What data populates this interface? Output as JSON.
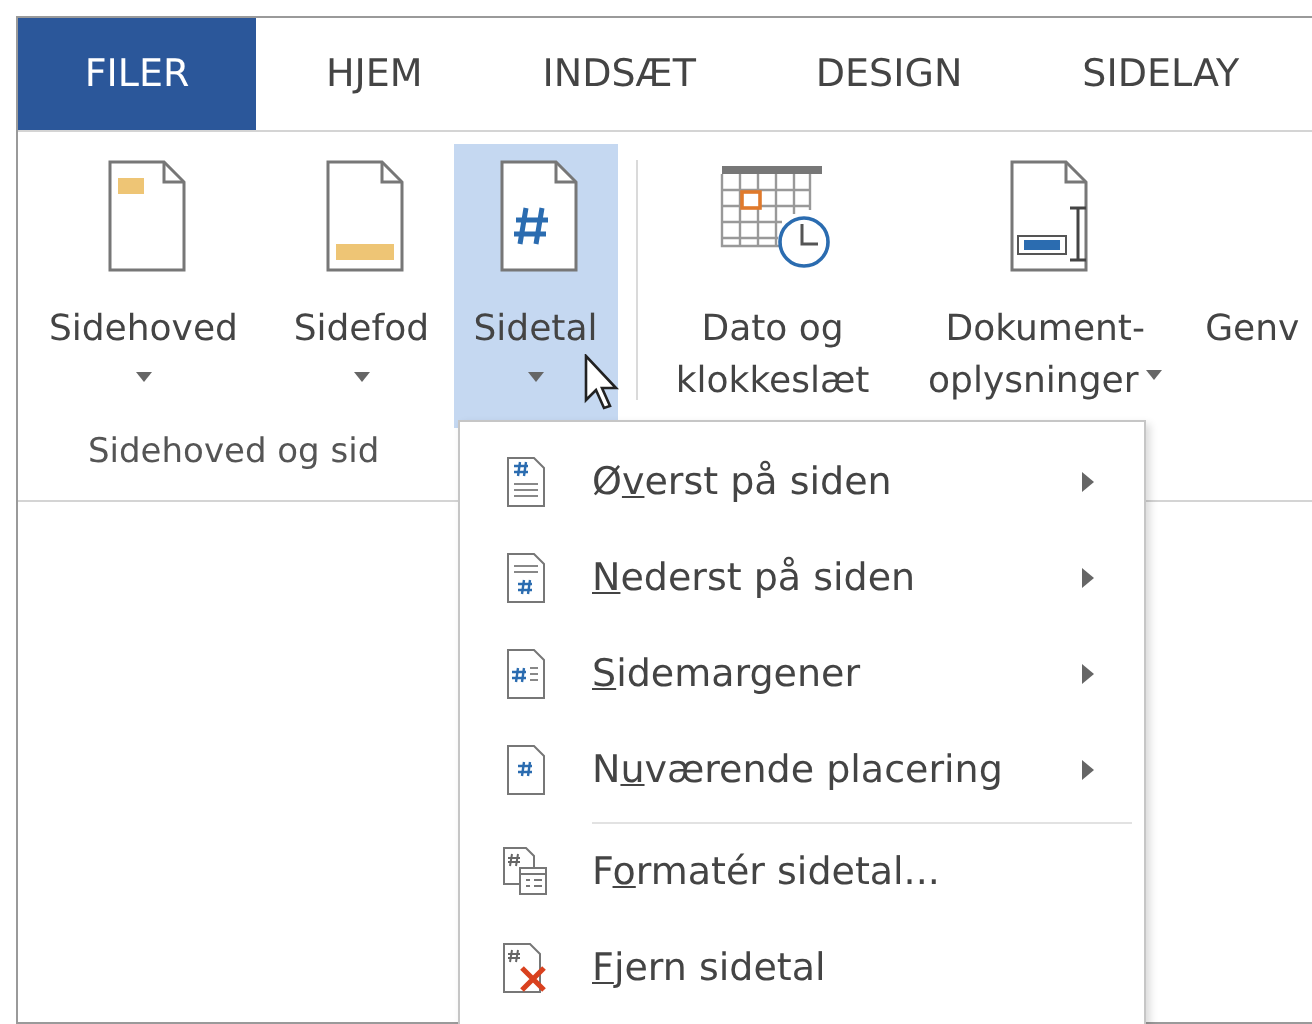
{
  "tabs": [
    {
      "label": "FILER",
      "selected": true
    },
    {
      "label": "HJEM",
      "selected": false
    },
    {
      "label": "INDSÆT",
      "selected": false
    },
    {
      "label": "DESIGN",
      "selected": false
    },
    {
      "label": "SIDELAY",
      "selected": false
    }
  ],
  "ribbon": {
    "buttons": [
      {
        "lines": [
          "Sidehoved"
        ],
        "dropdown": true,
        "selected": false
      },
      {
        "lines": [
          "Sidefod"
        ],
        "dropdown": true,
        "selected": false
      },
      {
        "lines": [
          "Sidetal"
        ],
        "dropdown": true,
        "selected": true
      },
      {
        "lines": [
          "Dato og",
          "klokkeslæt"
        ],
        "dropdown": false,
        "selected": false
      },
      {
        "lines": [
          "Dokument-",
          "oplysninger"
        ],
        "dropdown": true,
        "selected": false
      },
      {
        "lines": [
          "Genv"
        ],
        "dropdown": false,
        "selected": false
      }
    ],
    "group_label": "Sidehoved og sid"
  },
  "menu": {
    "items": [
      {
        "pre": "Ø",
        "key": "v",
        "post": "erst på siden",
        "kind": "submenu"
      },
      {
        "key": "N",
        "post": "ederst på siden",
        "kind": "submenu"
      },
      {
        "key": "S",
        "post": "idemargener",
        "kind": "submenu"
      },
      {
        "pre": "N",
        "key": "u",
        "post": "værende placering",
        "kind": "submenu"
      },
      {
        "pre": "F",
        "key": "o",
        "post": "rmatér sidetal...",
        "kind": "action"
      },
      {
        "key": "F",
        "post": "jern sidetal",
        "kind": "action"
      }
    ]
  }
}
